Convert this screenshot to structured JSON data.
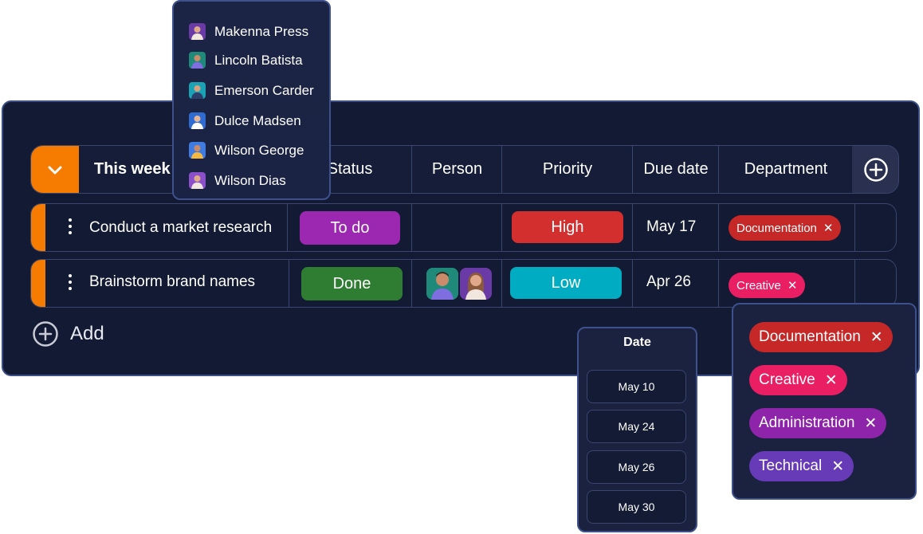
{
  "group": {
    "title": "This week"
  },
  "columns": [
    "Status",
    "Person",
    "Priority",
    "Due date",
    "Department"
  ],
  "rows": [
    {
      "name": "Conduct a market research",
      "status": {
        "label": "To do",
        "color": "#9c27b0"
      },
      "priority": {
        "label": "High",
        "color": "#d32f2f"
      },
      "due": "May 17",
      "department": {
        "label": "Documentation",
        "color": "#c62828"
      }
    },
    {
      "name": "Brainstorm brand names",
      "status": {
        "label": "Done",
        "color": "#2e7d32"
      },
      "priority": {
        "label": "Low",
        "color": "#00acc1"
      },
      "due": "Apr 26",
      "department": {
        "label": "Creative",
        "color": "#e91e63"
      }
    }
  ],
  "add_label": "Add",
  "people_menu": [
    "Makenna Press",
    "Lincoln Batista",
    "Emerson Carder",
    "Dulce Madsen",
    "Wilson George",
    "Wilson Dias"
  ],
  "date_menu": {
    "title": "Date",
    "options": [
      "May 10",
      "May 24",
      "May 26",
      "May 30"
    ]
  },
  "department_menu": [
    {
      "label": "Documentation",
      "color": "#c62828"
    },
    {
      "label": "Creative",
      "color": "#e91e63"
    },
    {
      "label": "Administration",
      "color": "#8e24aa"
    },
    {
      "label": "Technical",
      "color": "#673ab7"
    }
  ],
  "colors": {
    "accent": "#f57c00",
    "board_bg": "#131a33",
    "border": "#3a4670"
  },
  "icons": [
    "chevron-down-icon",
    "plus-circle-icon",
    "more-vertical-icon",
    "close-icon"
  ]
}
